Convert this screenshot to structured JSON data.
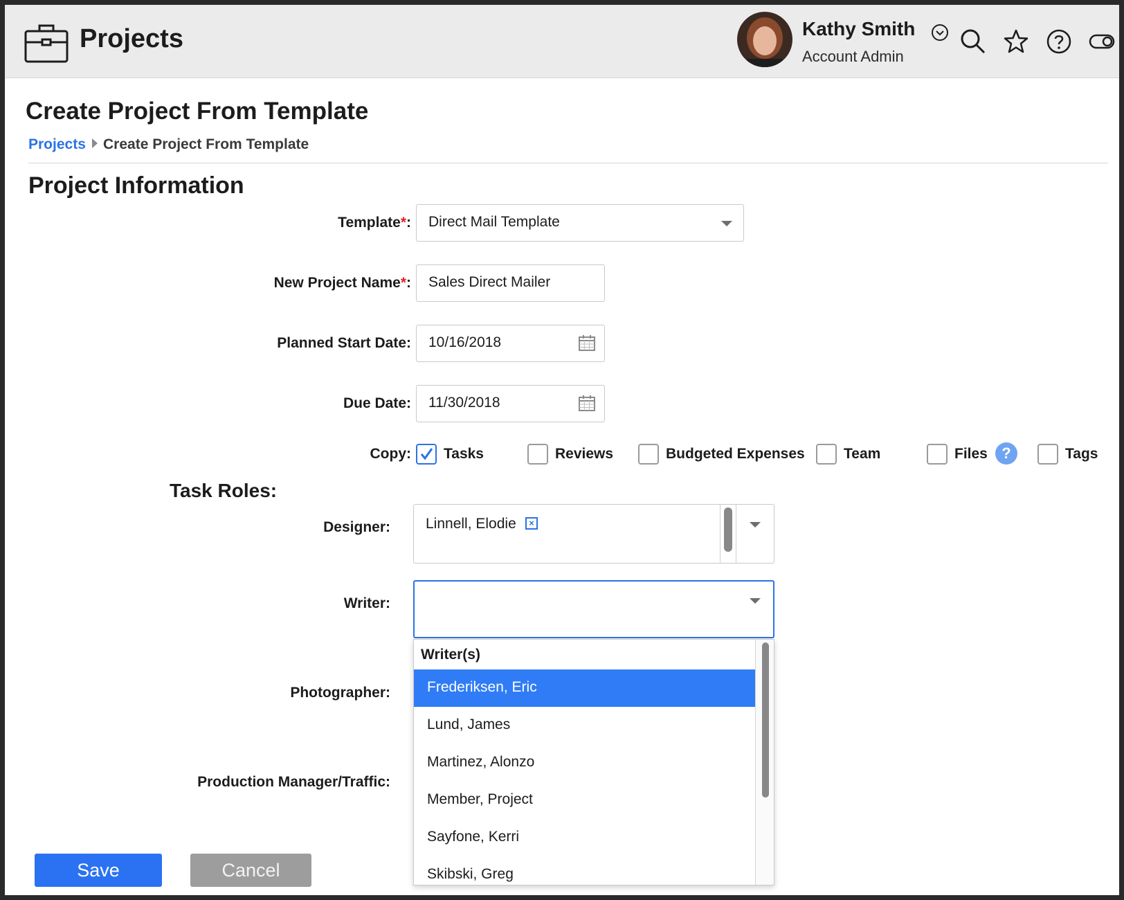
{
  "header": {
    "app_icon": "briefcase-icon",
    "app_title": "Projects",
    "user": {
      "name": "Kathy Smith",
      "role": "Account Admin"
    },
    "icons": [
      "chevron-down-icon",
      "search-icon",
      "star-icon",
      "help-icon",
      "toggle-icon"
    ]
  },
  "page": {
    "title": "Create Project From Template",
    "breadcrumb": {
      "link": "Projects",
      "current": "Create Project From Template"
    }
  },
  "form": {
    "section_title": "Project Information",
    "required_mark": "*",
    "template": {
      "label": "Template",
      "value": "Direct Mail Template"
    },
    "project_name": {
      "label": "New Project Name",
      "value": "Sales Direct Mailer"
    },
    "start_date": {
      "label": "Planned Start Date:",
      "value": "10/16/2018"
    },
    "due_date": {
      "label": "Due Date:",
      "value": "11/30/2018"
    },
    "copy": {
      "label": "Copy:",
      "options": [
        {
          "label": "Tasks",
          "checked": true
        },
        {
          "label": "Reviews",
          "checked": false
        },
        {
          "label": "Budgeted Expenses",
          "checked": false
        },
        {
          "label": "Team",
          "checked": false
        },
        {
          "label": "Files",
          "checked": false
        },
        {
          "label": "Tags",
          "checked": false
        }
      ],
      "help": "?"
    }
  },
  "task_roles": {
    "title": "Task Roles:",
    "designer": {
      "label": "Designer:",
      "selected": "Linnell, Elodie",
      "remove": "×"
    },
    "writer": {
      "label": "Writer:",
      "dropdown_header": "Writer(s)",
      "options": [
        "Frederiksen, Eric",
        "Lund, James",
        "Martinez, Alonzo",
        "Member, Project",
        "Sayfone, Kerri",
        "Skibski, Greg"
      ],
      "highlighted": "Frederiksen, Eric"
    },
    "photographer": {
      "label": "Photographer:"
    },
    "production_manager": {
      "label": "Production Manager/Traffic:"
    }
  },
  "buttons": {
    "save": "Save",
    "cancel": "Cancel"
  },
  "colors": {
    "accent": "#2a72f2",
    "link": "#2b73e6",
    "highlight": "#2f7cf6",
    "required": "#e02424"
  }
}
